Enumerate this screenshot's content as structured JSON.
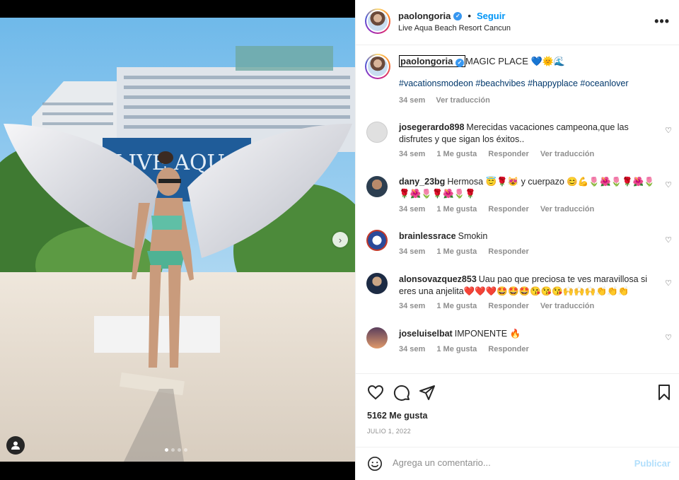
{
  "post": {
    "username": "paolongoria",
    "follow_label": "Seguir",
    "follow_dot": "•",
    "location": "Live Aqua Beach Resort Cancun",
    "more_label": "•••"
  },
  "caption": {
    "username": "paolongoria",
    "text": "MAGIC PLACE 💙🌞🌊",
    "hashtags": "#vacationsmodeon #beachvibes #happyplace #oceanlover",
    "time": "34 sem",
    "translate": "Ver traducción"
  },
  "comments": [
    {
      "user": "josegerardo898",
      "text": "Merecidas vacaciones campeona,que las disfrutes y que sigan los éxitos..",
      "time": "34 sem",
      "likes": "1 Me gusta",
      "reply": "Responder",
      "translate": "Ver traducción"
    },
    {
      "user": "dany_23bg",
      "text": "Hermosa 😇🌹😻 y cuerpazo 😊💪🌷🌺🌷🌹🌺🌷🌹🌺🌷🌹🌺🌷🌹",
      "time": "34 sem",
      "likes": "1 Me gusta",
      "reply": "Responder",
      "translate": "Ver traducción"
    },
    {
      "user": "brainlessrace",
      "text": "Smokin",
      "time": "34 sem",
      "likes": "1 Me gusta",
      "reply": "Responder"
    },
    {
      "user": "alonsovazquez853",
      "text": "Uau pao que preciosa te ves maravillosa si eres una anjelita❤️❤️❤️🤩🤩🤩😘😘😘🙌🙌🙌👏👏👏",
      "time": "34 sem",
      "likes": "1 Me gusta",
      "reply": "Responder",
      "translate": "Ver traducción"
    },
    {
      "user": "joseluiselbat",
      "text": "IMPONENTE 🔥",
      "time": "34 sem",
      "likes": "1 Me gusta",
      "reply": "Responder"
    }
  ],
  "stats": {
    "likes": "5162 Me gusta",
    "date": "JULIO 1, 2022"
  },
  "composer": {
    "placeholder": "Agrega un comentario...",
    "publish_label": "Publicar"
  },
  "media": {
    "next_label": "›"
  },
  "colors": {
    "link": "#0095f6",
    "hashtag": "#00376b",
    "muted": "#8e8e8e",
    "text": "#262626"
  }
}
